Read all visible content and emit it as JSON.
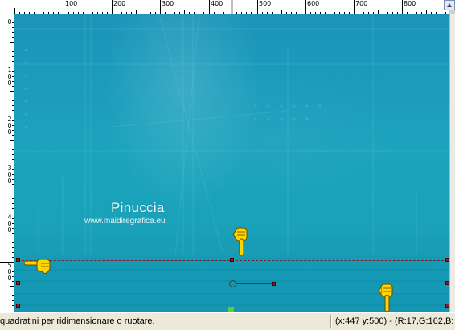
{
  "rulers": {
    "horizontal_labels": [
      "100",
      "200",
      "300",
      "400",
      "500",
      "600",
      "700",
      "800"
    ],
    "vertical_labels": [
      "0",
      "1\n0\n0",
      "2\n0\n0",
      "3\n0\n0",
      "4\n0\n0",
      "5\n0\n0"
    ]
  },
  "canvas": {
    "watermark_name": "Pinuccia",
    "watermark_site": "www.maidiregrafica.eu"
  },
  "status": {
    "message": "quadratini per ridimensionare o ruotare.",
    "coords": "(x:447 y:500) - (R:17,G:162,B:"
  },
  "colors": {
    "canvas_teal": "#1aa2ba",
    "selection_red": "#8a1420",
    "pivot_green": "#5cd12c"
  },
  "icons": {
    "pointer_hand": "pointing-hand-icon",
    "scroll_up": "arrow-up-icon"
  }
}
